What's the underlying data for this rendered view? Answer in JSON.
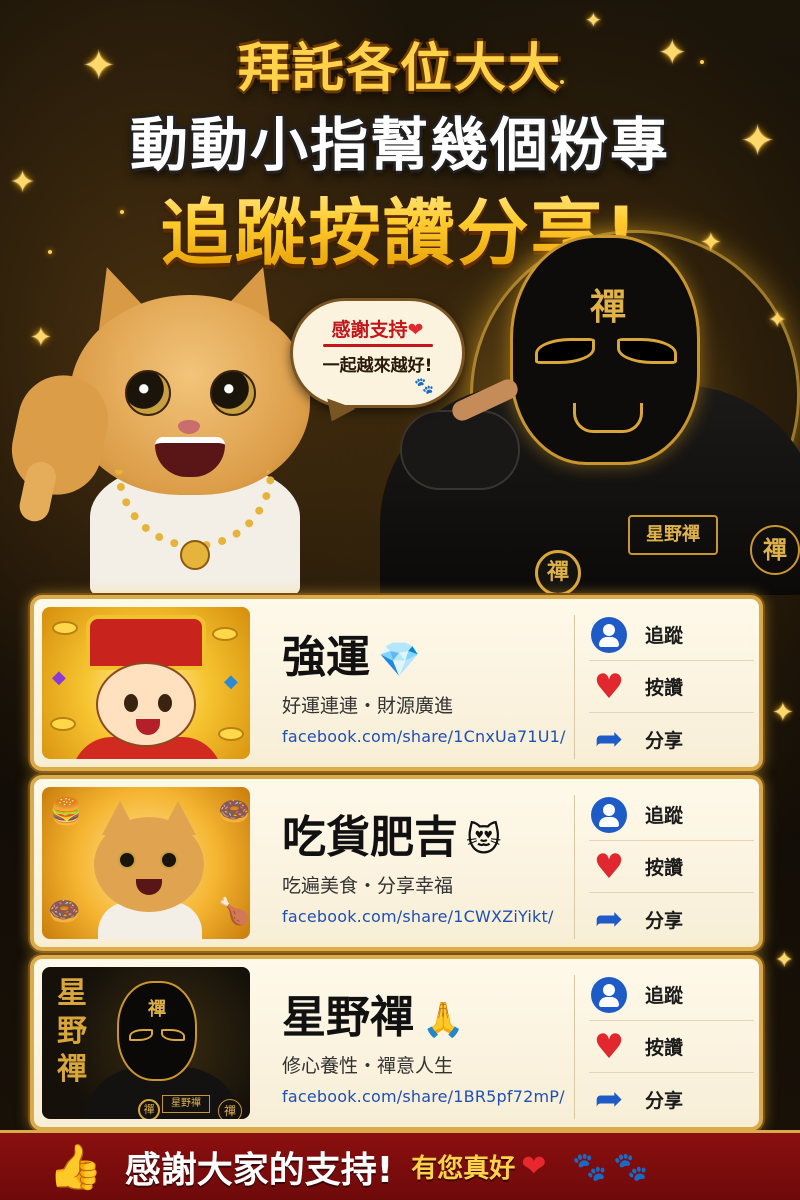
{
  "headline": {
    "line1": "拜託各位大大",
    "line2": "動動小指幫幾個粉專",
    "line3": "追蹤按讚分享!"
  },
  "bubble": {
    "line1": "感謝支持",
    "heart": "❤",
    "line2": "一起越來越好!",
    "paw": "🐾"
  },
  "hero": {
    "mask_kanji": "禪",
    "patch_text": "星野禪",
    "medal_text": "禪",
    "sleeve_text": "禪"
  },
  "actions": {
    "follow": "追蹤",
    "like": "按讚",
    "share": "分享"
  },
  "icons": {
    "follow": "user-icon",
    "like": "heart-icon",
    "share": "share-arrow-icon"
  },
  "cards": [
    {
      "name": "強運",
      "emoji": "💎",
      "subtitle": "好運連連・財源廣進",
      "link": "facebook.com/share/1CnxUa71U1/"
    },
    {
      "name": "吃貨肥吉",
      "emoji": "😻",
      "subtitle": "吃遍美食・分享幸福",
      "link": "facebook.com/share/1CWXZiYikt/"
    },
    {
      "name": "星野禪",
      "emoji": "🙏",
      "subtitle": "修心養性・禪意人生",
      "link": "facebook.com/share/1BR5pf72mP/",
      "thumb_vertical_text": "星野禪",
      "thumb_mask_kanji": "禪",
      "thumb_patch_text": "星野禪",
      "thumb_medal_text": "禪",
      "thumb_sleeve_text": "禪"
    }
  ],
  "footer": {
    "thumb": "👍",
    "main": "感謝大家的支持!",
    "sub": "有您真好",
    "heart": "❤",
    "paws": "🐾🐾"
  },
  "colors": {
    "gold": "#d9ab4a",
    "footer_red": "#8b0f0f",
    "link_blue": "#1e4fb4",
    "icon_blue": "#1f5bc7",
    "heart_red": "#e0282e"
  }
}
